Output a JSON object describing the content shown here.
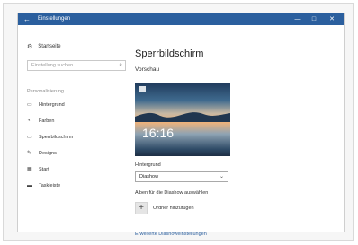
{
  "window": {
    "title": "Einstellungen",
    "back_glyph": "←",
    "minimize_glyph": "—",
    "maximize_glyph": "□",
    "close_glyph": "✕"
  },
  "sidebar": {
    "home_label": "Startseite",
    "search_placeholder": "Einstellung suchen",
    "section_label": "Personalisierung",
    "items": [
      {
        "label": "Hintergrund",
        "icon": "image-icon"
      },
      {
        "label": "Farben",
        "icon": "palette-icon"
      },
      {
        "label": "Sperrbildschirm",
        "icon": "lock-screen-icon"
      },
      {
        "label": "Designs",
        "icon": "brush-icon"
      },
      {
        "label": "Start",
        "icon": "start-icon"
      },
      {
        "label": "Taskleiste",
        "icon": "taskbar-icon"
      }
    ]
  },
  "main": {
    "title": "Sperrbildschirm",
    "preview_label": "Vorschau",
    "preview_time": "16:16",
    "background_label": "Hintergrund",
    "background_value": "Diashow",
    "albums_label": "Alben für die Diashow auswählen",
    "add_folder_label": "Ordner hinzufügen",
    "advanced_link": "Erweiterte Diashoweinstellungen"
  },
  "colors": {
    "titlebar": "#2b5f9e",
    "link": "#2b5f9e"
  }
}
